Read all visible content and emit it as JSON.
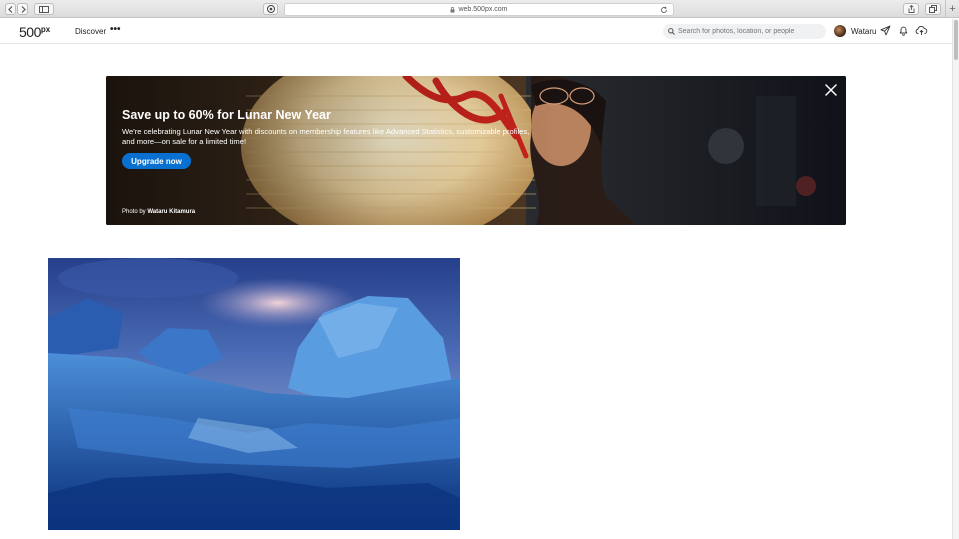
{
  "browser": {
    "url": "web.500px.com"
  },
  "nav": {
    "logo_main": "500",
    "logo_sup": "px",
    "discover": "Discover",
    "more": "•••",
    "search_placeholder": "Search for photos, location, or people",
    "username": "Wataru",
    "icons": [
      "send-icon",
      "bell-icon",
      "upload-cloud-icon"
    ]
  },
  "banner": {
    "title": "Save up to 60% for Lunar New Year",
    "text": "We're celebrating Lunar New Year with discounts on membership features like Advanced Statistics, customizable profiles, and more—on sale for a limited time!",
    "button": "Upgrade now",
    "credit_prefix": "Photo by ",
    "credit_name": "Wataru Kitamura"
  },
  "colors": {
    "accent": "#0870d1",
    "nav_text": "#222222"
  }
}
